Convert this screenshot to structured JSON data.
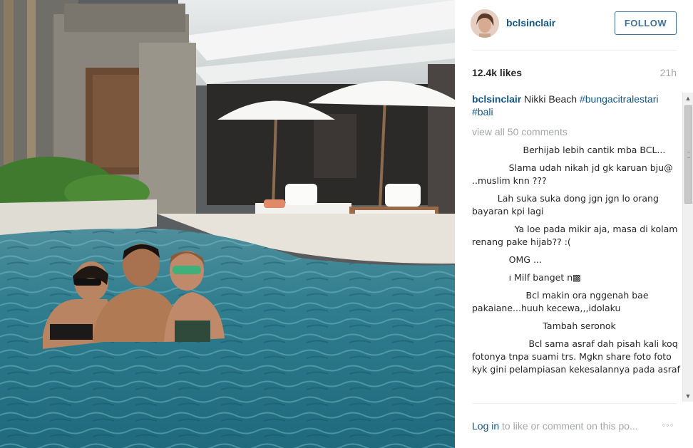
{
  "post": {
    "username": "bclsinclair",
    "follow_label": "FOLLOW",
    "likes": "12.4k likes",
    "time_ago": "21h",
    "caption": {
      "username": "bclsinclair",
      "text": "Nikki Beach",
      "hashtags": [
        "#bungacitralestari",
        "#bali"
      ]
    },
    "view_all_comments": "view all 50 comments",
    "comments": [
      "                  Berhijab lebih cantik mba BCL...",
      "             Slama udah nikah jd gk karuan bju@  ..muslim knn ???",
      "         Lah suka suka dong jgn jgn lo orang bayaran kpi lagi",
      "               Ya loe pada mikir aja, masa di kolam renang pake hijab?? :(",
      "             OMG ...",
      "             ı Milf banget n▩",
      "                   Bcl makin ora nggenah bae pakaiane...huuh kecewa,,,idolaku",
      "                         Tambah seronok",
      "                    Bcl sama asraf dah pisah kali koq fotonya tnpa suami trs. Mgkn share foto foto kyk gini pelampiasan kekesalannya pada asraf"
    ],
    "footer": {
      "login_link": "Log in",
      "login_rest": "to like or comment on this po...",
      "more_icon": "◦◦◦"
    }
  },
  "colors": {
    "link": "#125688",
    "follow": "#3f729b",
    "muted": "#a5a7aa"
  }
}
